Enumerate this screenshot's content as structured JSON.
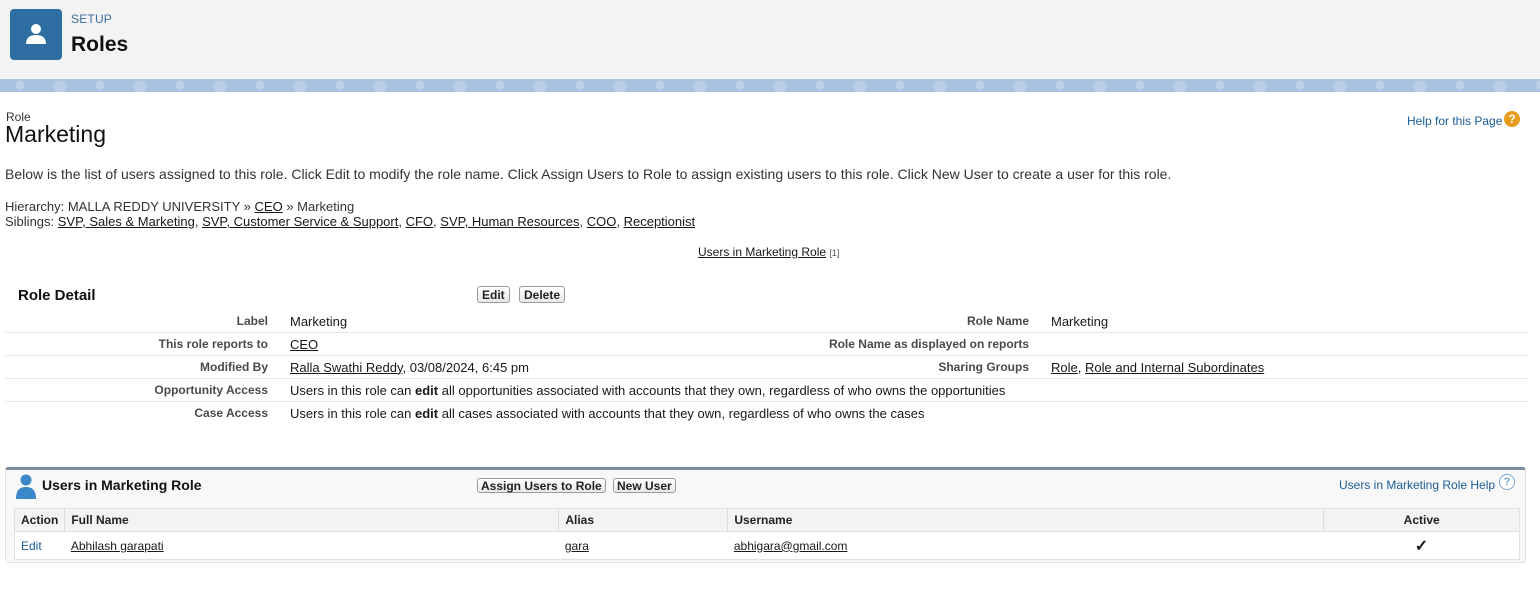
{
  "header": {
    "setup_label": "SETUP",
    "title": "Roles",
    "icon": "user-icon"
  },
  "page": {
    "kicker": "Role",
    "role_name": "Marketing",
    "help_link": "Help for this Page",
    "description": "Below is the list of users assigned to this role. Click Edit to modify the role name. Click Assign Users to Role to assign existing users to this role. Click New User to create a user for this role.",
    "hierarchy": {
      "label": "Hierarchy: MALLA REDDY UNIVERSITY »",
      "ceo": "CEO",
      "tail": "» Marketing"
    },
    "siblings": {
      "label": "Siblings:",
      "items": [
        "SVP, Sales & Marketing",
        "SVP, Customer Service & Support",
        "CFO",
        "SVP, Human Resources",
        "COO",
        "Receptionist"
      ]
    },
    "jump_link": "Users in Marketing Role",
    "jump_count": "[1]"
  },
  "detail": {
    "title": "Role Detail",
    "edit_label": "Edit",
    "delete_label": "Delete",
    "label_label": "Label",
    "label_value": "Marketing",
    "role_name_label": "Role Name",
    "role_name_value": "Marketing",
    "reports_label": "This role reports to",
    "reports_value": "CEO",
    "display_label": "Role Name as displayed on reports",
    "display_value": "",
    "modified_label": "Modified By",
    "modified_user": "Ralla Swathi Reddy",
    "modified_date": ", 03/08/2024, 6:45 pm",
    "sharing_label": "Sharing Groups",
    "sharing_role": "Role",
    "sharing_sep": ", ",
    "sharing_sub": "Role and Internal Subordinates",
    "opp_label": "Opportunity Access",
    "opp_pre": "Users in this role can ",
    "opp_bold": "edit",
    "opp_post": " all opportunities associated with accounts that they own, regardless of who owns the opportunities",
    "case_label": "Case Access",
    "case_pre": "Users in this role can ",
    "case_bold": "edit",
    "case_post": " all cases associated with accounts that they own, regardless of who owns the cases"
  },
  "users_list": {
    "title": "Users in Marketing Role",
    "assign_label": "Assign Users to Role",
    "new_user_label": "New User",
    "help_link": "Users in Marketing Role Help",
    "columns": {
      "action": "Action",
      "full_name": "Full Name",
      "alias": "Alias",
      "username": "Username",
      "active": "Active"
    },
    "rows": [
      {
        "action": "Edit",
        "full_name": "Abhilash garapati",
        "alias": "gara",
        "username": "abhigara@gmail.com",
        "active": "✓"
      }
    ]
  },
  "colors": {
    "setup_icon_bg": "#2f6ea3",
    "link_blue": "#1b5c99",
    "help_orange": "#e89a1c",
    "band": "#a9c2df"
  }
}
